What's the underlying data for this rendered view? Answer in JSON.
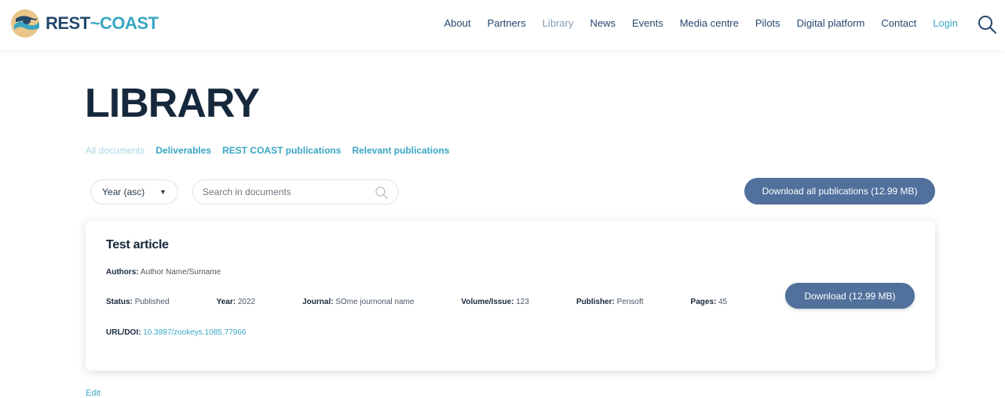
{
  "header": {
    "logo_text_rest": "REST",
    "logo_text_sep": "~",
    "logo_text_coast": "COAST",
    "nav": {
      "about": "About",
      "partners": "Partners",
      "library": "Library",
      "news": "News",
      "events": "Events",
      "media_centre": "Media centre",
      "pilots": "Pilots",
      "digital_platform": "Digital platform",
      "contact": "Contact",
      "login": "Login"
    }
  },
  "page": {
    "title": "LIBRARY"
  },
  "tabs": {
    "all": "All documents",
    "deliverables": "Deliverables",
    "rest_coast_publications": "REST COAST publications",
    "relevant_publications": "Relevant publications"
  },
  "controls": {
    "sort_value": "Year (asc)",
    "search_placeholder": "Search in documents",
    "download_all_label": "Download all publications (12.99 MB)"
  },
  "document": {
    "title": "Test article",
    "authors_label": "Authors:",
    "authors_value": "Author Name/Surname",
    "status_label": "Status:",
    "status_value": "Published",
    "year_label": "Year:",
    "year_value": "2022",
    "journal_label": "Journal:",
    "journal_value": "SOme journonal name",
    "volume_label": "Volume/Issue:",
    "volume_value": "123",
    "publisher_label": "Publisher:",
    "publisher_value": "Pensoft",
    "pages_label": "Pages:",
    "pages_value": "45",
    "url_label": "URL/DOI:",
    "url_value": "10.3897/zookeys.1085.77966",
    "download_label": "Download (12.99 MB)"
  },
  "footer": {
    "edit_label": "Edit"
  },
  "colors": {
    "navy": "#16283b",
    "accent": "#3aa6c4",
    "button": "#51709c"
  }
}
